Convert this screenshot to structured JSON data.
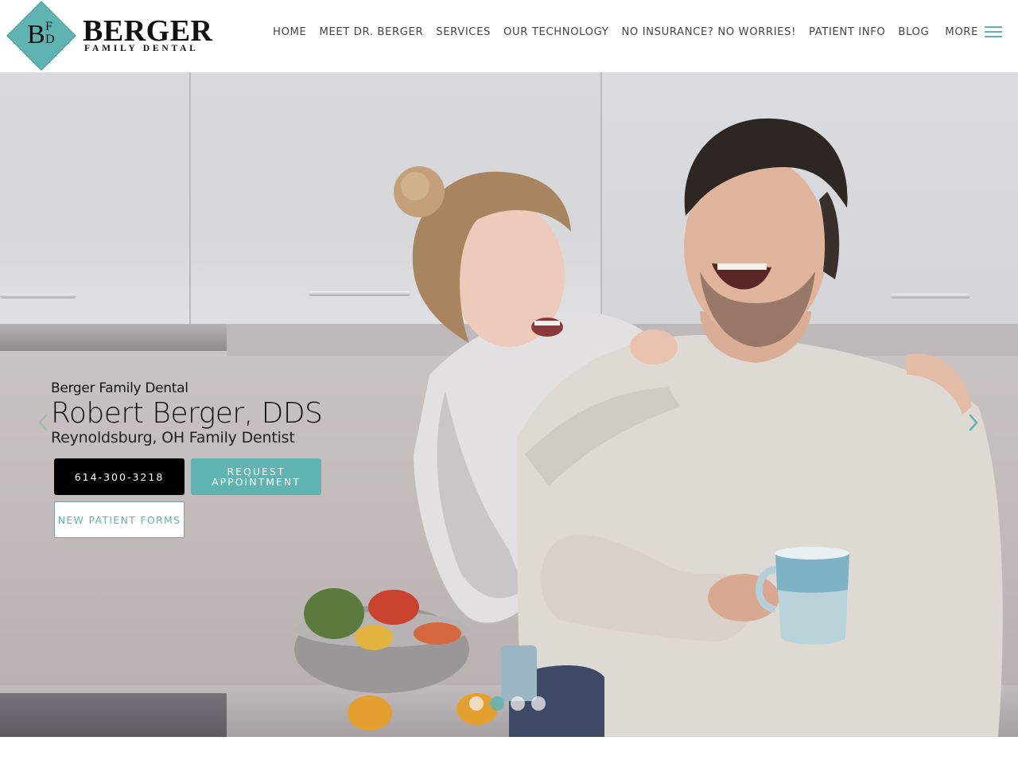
{
  "brand": {
    "monogram": {
      "b": "B",
      "f": "F",
      "d": "D"
    },
    "name": "BERGER",
    "subtitle": "FAMILY DENTAL",
    "accent_color": "#5fb3b0"
  },
  "nav": {
    "items": [
      {
        "label": "HOME"
      },
      {
        "label": "MEET DR. BERGER"
      },
      {
        "label": "SERVICES"
      },
      {
        "label": "OUR TECHNOLOGY"
      },
      {
        "label": "NO INSURANCE? NO WORRIES!"
      },
      {
        "label": "PATIENT INFO"
      },
      {
        "label": "BLOG"
      }
    ],
    "more_label": "MORE",
    "menu_icon": "hamburger-menu-icon"
  },
  "hero": {
    "practice_name": "Berger Family Dental",
    "doctor_name": "Robert Berger, DDS",
    "tagline": "Reynoldsburg, OH Family Dentist",
    "buttons": {
      "phone": "614-300-3218",
      "appointment_line1": "REQUEST",
      "appointment_line2": "APPOINTMENT",
      "forms": "NEW PATIENT FORMS"
    },
    "image_description": "Laughing couple in a bright kitchen, man holding a blue mug",
    "carousel": {
      "prev_icon": "chevron-left-icon",
      "next_icon": "chevron-right-icon",
      "slide_count": 4,
      "active_slide": 2
    }
  }
}
